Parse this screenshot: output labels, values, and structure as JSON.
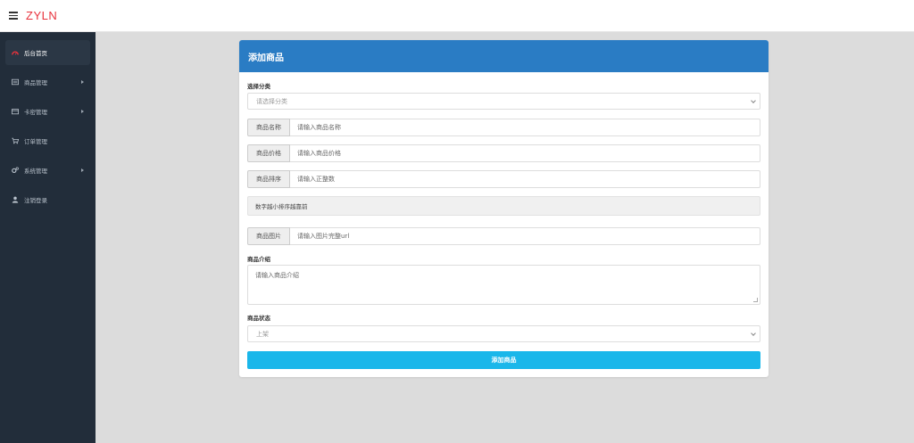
{
  "brand": {
    "name": "ZYLN"
  },
  "sidebar": {
    "items": [
      {
        "label": "后台首页",
        "icon": "dashboard-icon",
        "active": true
      },
      {
        "label": "商品管理",
        "icon": "list-icon",
        "has_submenu": true
      },
      {
        "label": "卡密管理",
        "icon": "card-icon",
        "has_submenu": true
      },
      {
        "label": "订单管理",
        "icon": "cart-icon"
      },
      {
        "label": "系统管理",
        "icon": "gears-icon",
        "has_submenu": true
      },
      {
        "label": "注销登录",
        "icon": "user-icon"
      }
    ]
  },
  "form": {
    "title": "添加商品",
    "category": {
      "label": "选择分类",
      "value": "请选择分类"
    },
    "name": {
      "addon": "商品名称",
      "placeholder": "请输入商品名称"
    },
    "price": {
      "addon": "商品价格",
      "placeholder": "请输入商品价格"
    },
    "sort": {
      "addon": "商品排序",
      "placeholder": "请输入正整数"
    },
    "sort_hint": "数字越小排序越靠前",
    "image": {
      "addon": "商品图片",
      "placeholder": "请输入图片完整url"
    },
    "intro": {
      "label": "商品介绍",
      "placeholder": "请输入商品介绍"
    },
    "status": {
      "label": "商品状态",
      "value": "上架"
    },
    "submit_label": "添加商品"
  },
  "colors": {
    "header": "#2a7cc4",
    "submit": "#1ab7ea",
    "sidebar": "#222d3a",
    "brand": "#e8323c"
  }
}
